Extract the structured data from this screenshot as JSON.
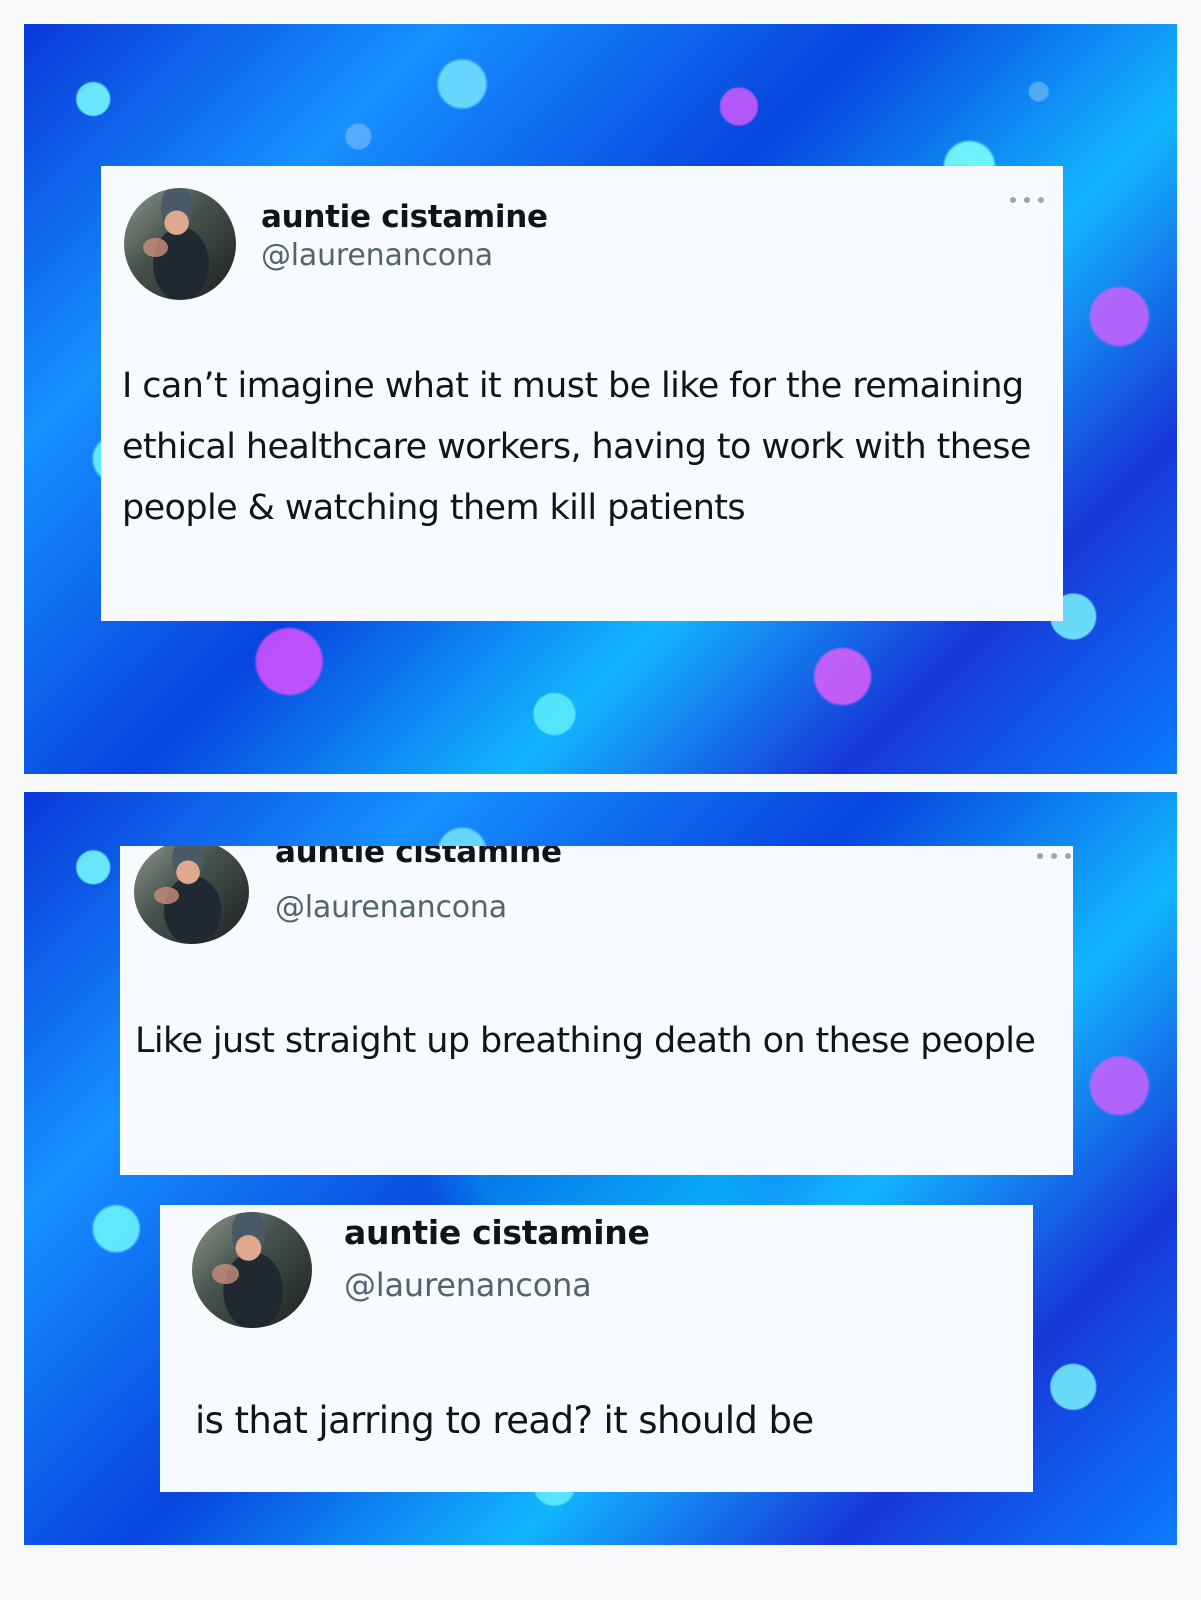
{
  "tweets": [
    {
      "display_name": "auntie cistamine",
      "handle": "@laurenancona",
      "text": "I can’t imagine what it must be like for the remaining ethical healthcare workers, having to work with these people & watching them kill patients"
    },
    {
      "display_name": "auntie cistamine",
      "handle": "@laurenancona",
      "text": "Like just straight up breathing death on these people"
    },
    {
      "display_name": "auntie cistamine",
      "handle": "@laurenancona",
      "text": "is that jarring to read? it should be"
    }
  ],
  "icons": {
    "more_options": "more-options-icon",
    "avatar": "profile-avatar"
  },
  "colors": {
    "card_background": "#f8fbfd",
    "primary_text": "#0f1419",
    "secondary_text": "#536471",
    "background_blue": "#0b52e6",
    "background_cyan": "#7df7ff",
    "background_magenta": "#d84dff"
  }
}
